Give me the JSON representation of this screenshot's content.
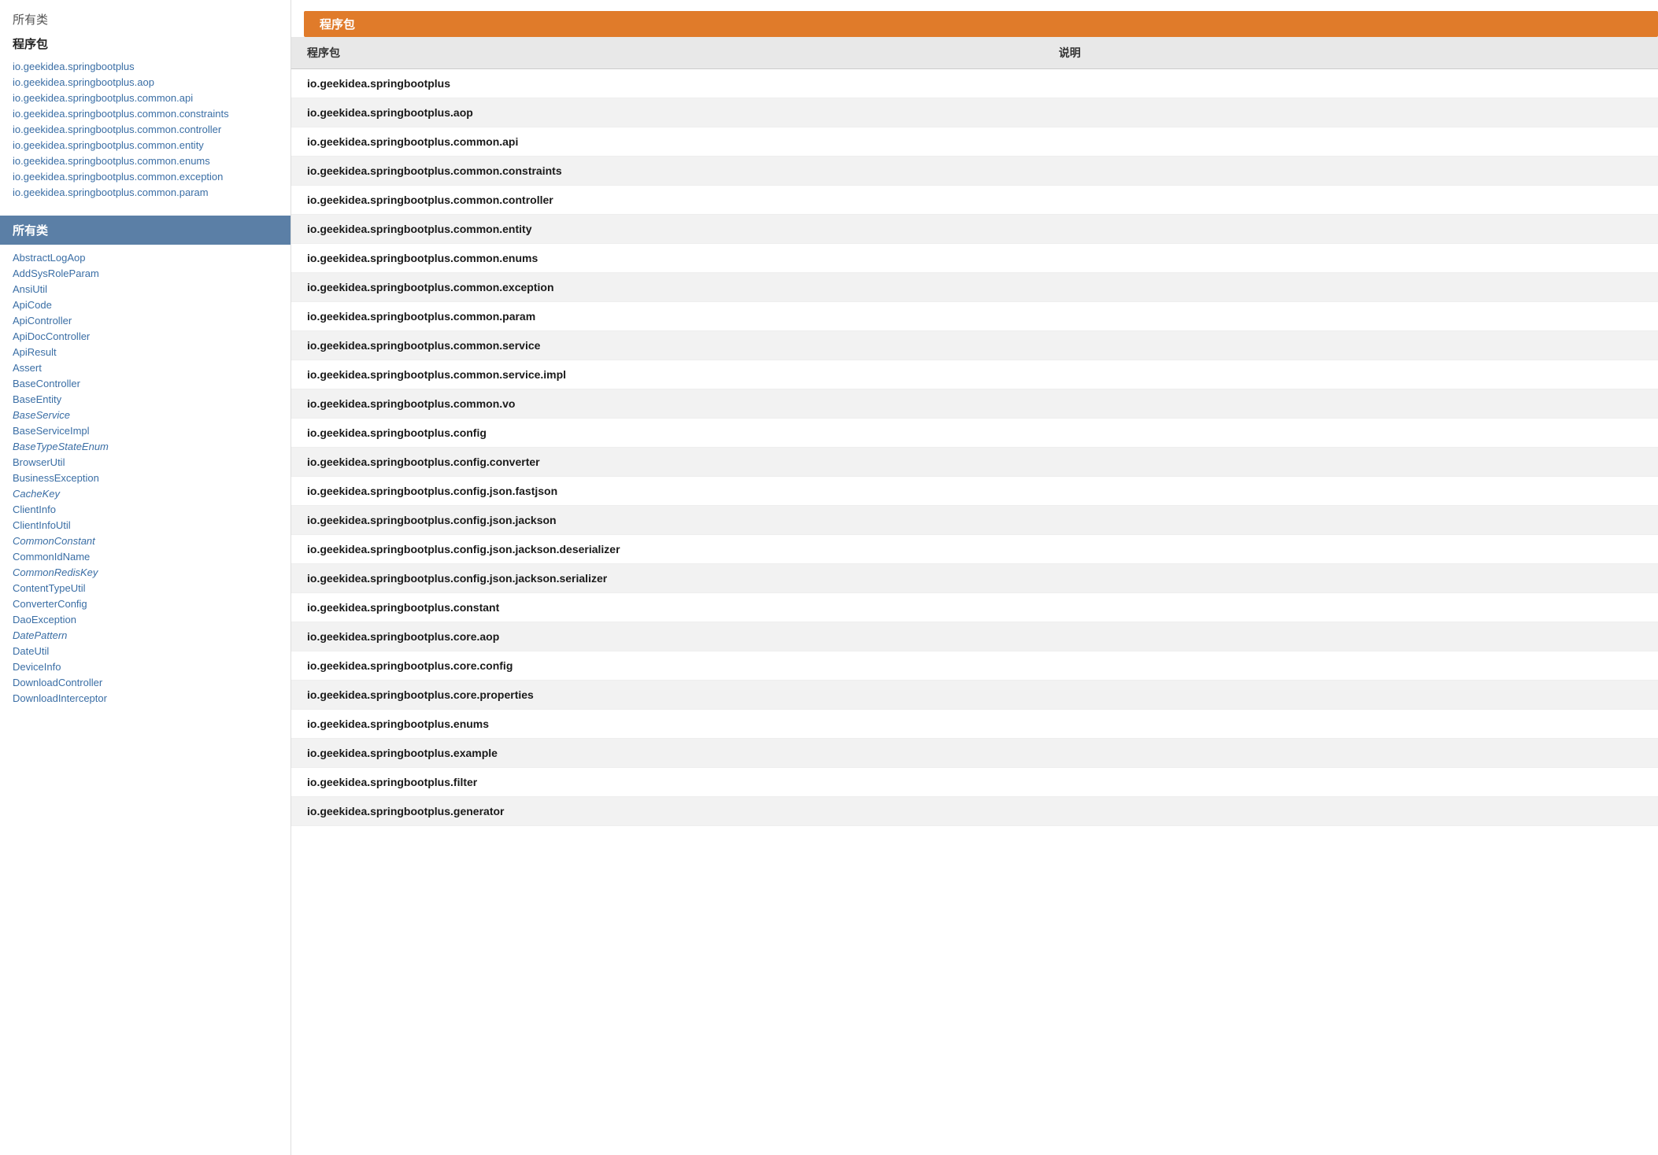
{
  "sidebar": {
    "all_label": "所有类",
    "packages_title": "程序包",
    "packages": [
      "io.geekidea.springbootplus",
      "io.geekidea.springbootplus.aop",
      "io.geekidea.springbootplus.common.api",
      "io.geekidea.springbootplus.common.constraints",
      "io.geekidea.springbootplus.common.controller",
      "io.geekidea.springbootplus.common.entity",
      "io.geekidea.springbootplus.common.enums",
      "io.geekidea.springbootplus.common.exception",
      "io.geekidea.springbootplus.common.param"
    ],
    "classes_header": "所有类",
    "classes": [
      {
        "name": "AbstractLogAop",
        "italic": false
      },
      {
        "name": "AddSysRoleParam",
        "italic": false
      },
      {
        "name": "AnsiUtil",
        "italic": false
      },
      {
        "name": "ApiCode",
        "italic": false
      },
      {
        "name": "ApiController",
        "italic": false
      },
      {
        "name": "ApiDocController",
        "italic": false
      },
      {
        "name": "ApiResult",
        "italic": false
      },
      {
        "name": "Assert",
        "italic": false
      },
      {
        "name": "BaseController",
        "italic": false
      },
      {
        "name": "BaseEntity",
        "italic": false
      },
      {
        "name": "BaseService",
        "italic": true
      },
      {
        "name": "BaseServiceImpl",
        "italic": false
      },
      {
        "name": "BaseTypeStateEnum",
        "italic": true
      },
      {
        "name": "BrowserUtil",
        "italic": false
      },
      {
        "name": "BusinessException",
        "italic": false
      },
      {
        "name": "CacheKey",
        "italic": true
      },
      {
        "name": "ClientInfo",
        "italic": false
      },
      {
        "name": "ClientInfoUtil",
        "italic": false
      },
      {
        "name": "CommonConstant",
        "italic": true
      },
      {
        "name": "CommonIdName",
        "italic": false
      },
      {
        "name": "CommonRedisKey",
        "italic": true
      },
      {
        "name": "ContentTypeUtil",
        "italic": false
      },
      {
        "name": "ConverterConfig",
        "italic": false
      },
      {
        "name": "DaoException",
        "italic": false
      },
      {
        "name": "DatePattern",
        "italic": true
      },
      {
        "name": "DateUtil",
        "italic": false
      },
      {
        "name": "DeviceInfo",
        "italic": false
      },
      {
        "name": "DownloadController",
        "italic": false
      },
      {
        "name": "DownloadInterceptor",
        "italic": false
      }
    ]
  },
  "main": {
    "header_tag": "程序包",
    "table_header_package": "程序包",
    "table_header_description": "说明",
    "packages": [
      {
        "name": "io.geekidea.springbootplus",
        "description": ""
      },
      {
        "name": "io.geekidea.springbootplus.aop",
        "description": ""
      },
      {
        "name": "io.geekidea.springbootplus.common.api",
        "description": ""
      },
      {
        "name": "io.geekidea.springbootplus.common.constraints",
        "description": ""
      },
      {
        "name": "io.geekidea.springbootplus.common.controller",
        "description": ""
      },
      {
        "name": "io.geekidea.springbootplus.common.entity",
        "description": ""
      },
      {
        "name": "io.geekidea.springbootplus.common.enums",
        "description": ""
      },
      {
        "name": "io.geekidea.springbootplus.common.exception",
        "description": ""
      },
      {
        "name": "io.geekidea.springbootplus.common.param",
        "description": ""
      },
      {
        "name": "io.geekidea.springbootplus.common.service",
        "description": ""
      },
      {
        "name": "io.geekidea.springbootplus.common.service.impl",
        "description": ""
      },
      {
        "name": "io.geekidea.springbootplus.common.vo",
        "description": ""
      },
      {
        "name": "io.geekidea.springbootplus.config",
        "description": ""
      },
      {
        "name": "io.geekidea.springbootplus.config.converter",
        "description": ""
      },
      {
        "name": "io.geekidea.springbootplus.config.json.fastjson",
        "description": ""
      },
      {
        "name": "io.geekidea.springbootplus.config.json.jackson",
        "description": ""
      },
      {
        "name": "io.geekidea.springbootplus.config.json.jackson.deserializer",
        "description": ""
      },
      {
        "name": "io.geekidea.springbootplus.config.json.jackson.serializer",
        "description": ""
      },
      {
        "name": "io.geekidea.springbootplus.constant",
        "description": ""
      },
      {
        "name": "io.geekidea.springbootplus.core.aop",
        "description": ""
      },
      {
        "name": "io.geekidea.springbootplus.core.config",
        "description": ""
      },
      {
        "name": "io.geekidea.springbootplus.core.properties",
        "description": ""
      },
      {
        "name": "io.geekidea.springbootplus.enums",
        "description": ""
      },
      {
        "name": "io.geekidea.springbootplus.example",
        "description": ""
      },
      {
        "name": "io.geekidea.springbootplus.filter",
        "description": ""
      },
      {
        "name": "io.geekidea.springbootplus.generator",
        "description": ""
      }
    ]
  }
}
